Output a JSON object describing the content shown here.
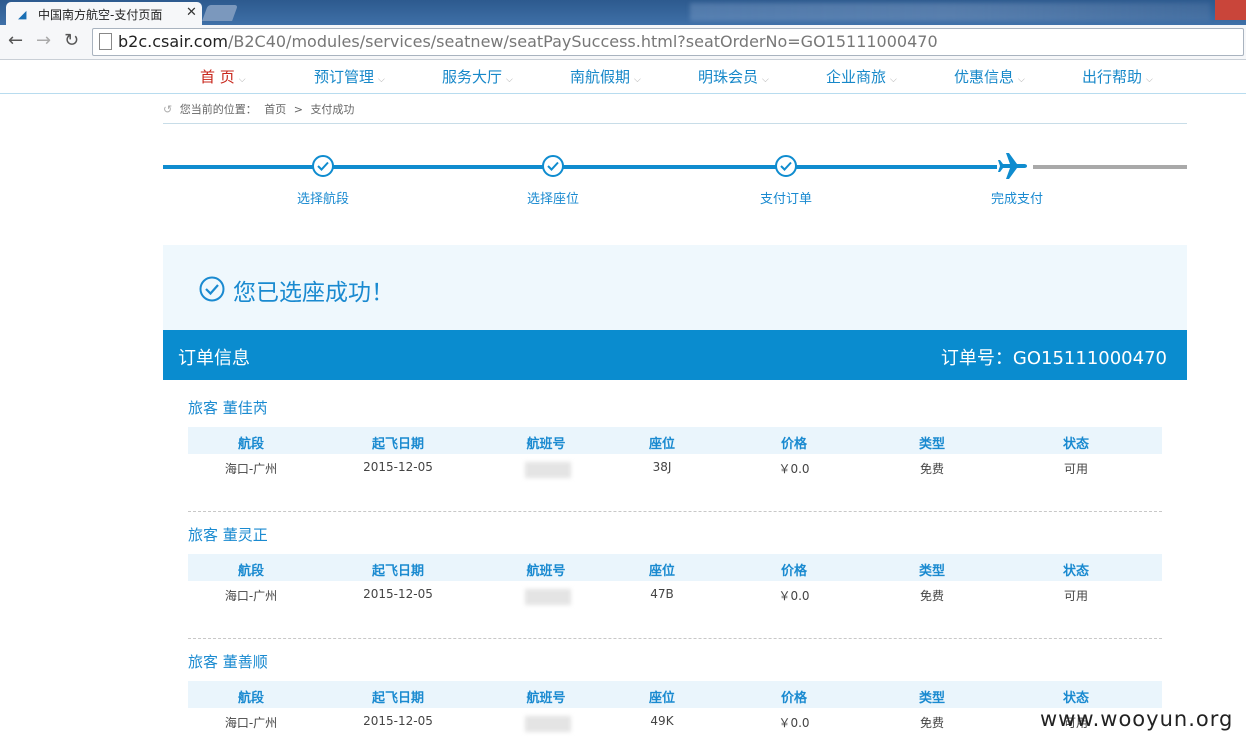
{
  "browser": {
    "tab_title": "中国南方航空-支付页面",
    "tab_close": "✕",
    "url_host": "b2c.csair.com",
    "url_path": "/B2C40/modules/services/seatnew/seatPaySuccess.html?seatOrderNo=GO15111000470"
  },
  "nav": {
    "items": [
      {
        "label": "首 页"
      },
      {
        "label": "预订管理"
      },
      {
        "label": "服务大厅"
      },
      {
        "label": "南航假期"
      },
      {
        "label": "明珠会员"
      },
      {
        "label": "企业商旅"
      },
      {
        "label": "优惠信息"
      },
      {
        "label": "出行帮助"
      }
    ],
    "active_color": "#c8261b",
    "color": "#1788c9"
  },
  "breadcrumb": {
    "prefix": "您当前的位置：",
    "home": "首页",
    "sep": ">",
    "current": "支付成功"
  },
  "progress": {
    "steps": [
      "选择航段",
      "选择座位",
      "支付订单",
      "完成支付"
    ],
    "current_step": 4
  },
  "banner": {
    "message": "您已选座成功！"
  },
  "order": {
    "title": "订单信息",
    "number_label": "订单号：GO15111000470"
  },
  "table_headers": [
    "航段",
    "起飞日期",
    "航班号",
    "座位",
    "价格",
    "类型",
    "状态"
  ],
  "passengers": [
    {
      "name": "旅客 董佳芮",
      "segment": "海口-广州",
      "date": "2015-12-05",
      "seat": "38J",
      "price": "￥0.0",
      "type": "免费",
      "status": "可用"
    },
    {
      "name": "旅客 董灵正",
      "segment": "海口-广州",
      "date": "2015-12-05",
      "seat": "47B",
      "price": "￥0.0",
      "type": "免费",
      "status": "可用"
    },
    {
      "name": "旅客 董善顺",
      "segment": "海口-广州",
      "date": "2015-12-05",
      "seat": "49K",
      "price": "￥0.0",
      "type": "免费",
      "status": "可用"
    }
  ],
  "watermark": "www.wooyun.org"
}
